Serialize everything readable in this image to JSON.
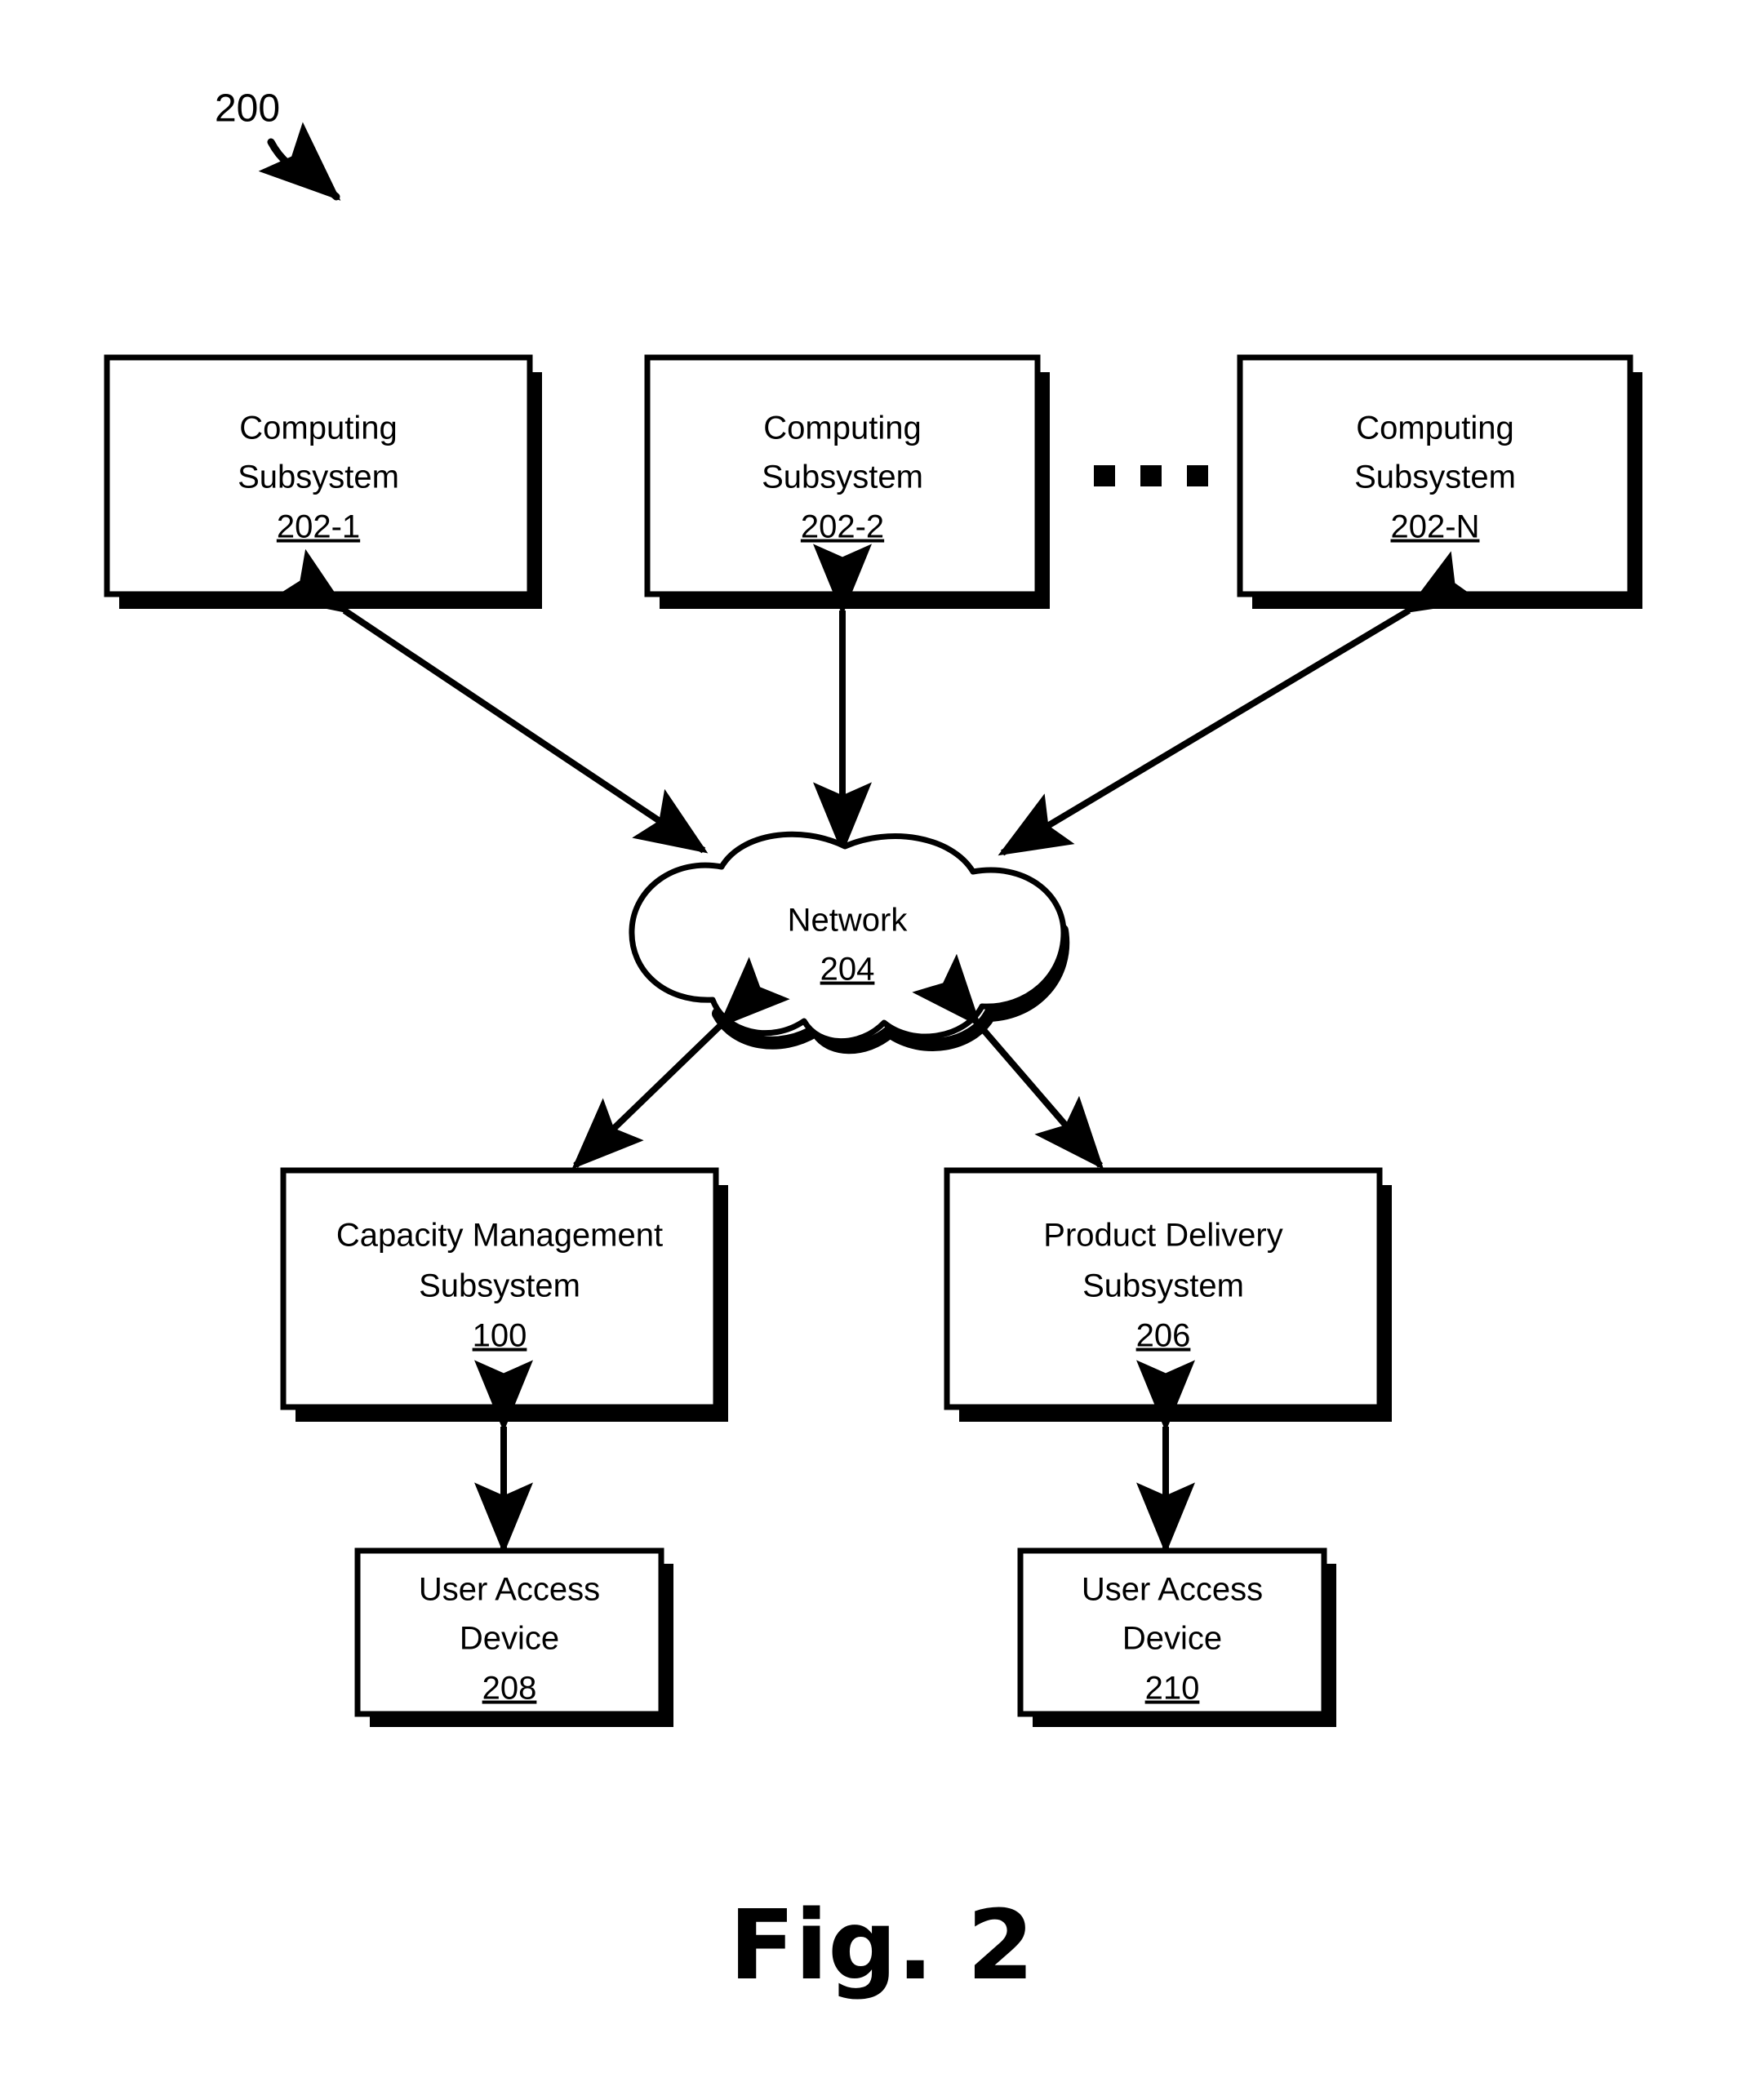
{
  "figure": {
    "caption": "Fig. 2",
    "system_label": "200",
    "ellipsis": "· · ·"
  },
  "nodes": {
    "computing_subsystem_1": {
      "line1": "Computing",
      "line2": "Subsystem",
      "ref": "202-1"
    },
    "computing_subsystem_2": {
      "line1": "Computing",
      "line2": "Subsystem",
      "ref": "202-2"
    },
    "computing_subsystem_n": {
      "line1": "Computing",
      "line2": "Subsystem",
      "ref": "202-N"
    },
    "network": {
      "line1": "Network",
      "ref": "204"
    },
    "capacity_management_subsystem": {
      "line1": "Capacity Management",
      "line2": "Subsystem",
      "ref": "100"
    },
    "product_delivery_subsystem": {
      "line1": "Product Delivery",
      "line2": "Subsystem",
      "ref": "206"
    },
    "user_access_device_208": {
      "line1": "User Access",
      "line2": "Device",
      "ref": "208"
    },
    "user_access_device_210": {
      "line1": "User Access",
      "line2": "Device",
      "ref": "210"
    }
  },
  "colors": {
    "stroke": "#000000",
    "fill": "#ffffff",
    "background": "#ffffff"
  }
}
